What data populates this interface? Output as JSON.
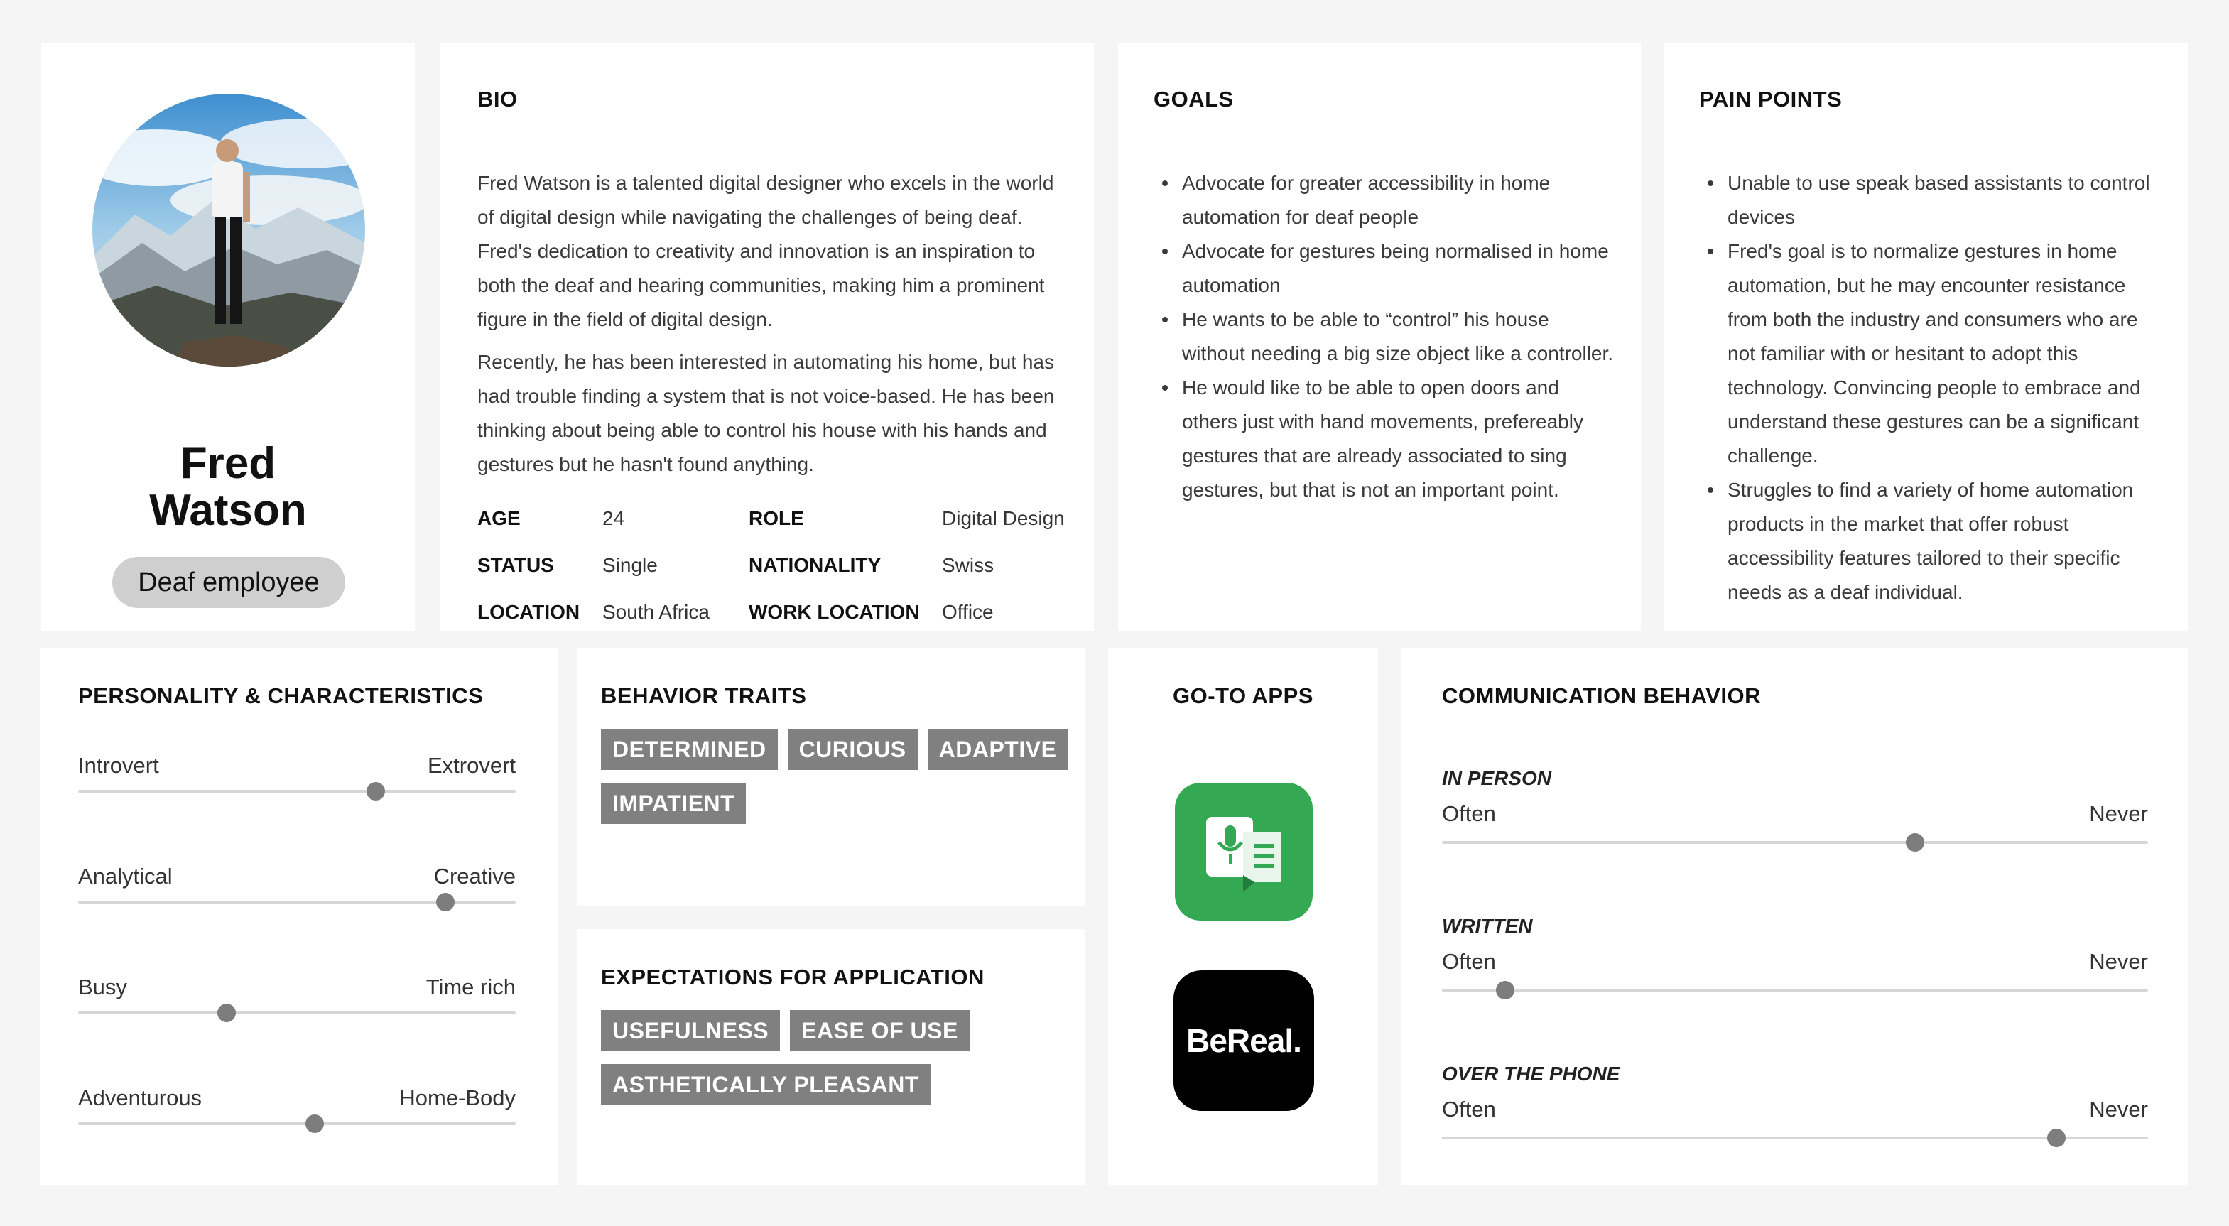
{
  "profile": {
    "first_name": "Fred",
    "last_name": "Watson",
    "badge": "Deaf employee"
  },
  "bio": {
    "heading": "BIO",
    "paragraph1": "Fred Watson is a talented digital designer who excels in the world of digital design while navigating the challenges of being deaf. Fred's dedication to creativity and innovation is an inspiration to both the deaf and hearing communities, making him a prominent figure in the field of digital design.",
    "paragraph2": "Recently, he has been interested in automating his home, but has had trouble finding a system that is not voice-based. He has been thinking about being able to control his house with his hands and gestures but he hasn't found anything.",
    "facts": [
      {
        "label": "AGE",
        "value": "24"
      },
      {
        "label": "ROLE",
        "value": "Digital Design"
      },
      {
        "label": "STATUS",
        "value": "Single"
      },
      {
        "label": "NATIONALITY",
        "value": "Swiss"
      },
      {
        "label": "LOCATION",
        "value": "South Africa"
      },
      {
        "label": "WORK LOCATION",
        "value": "Office"
      }
    ]
  },
  "goals": {
    "heading": "GOALS",
    "items": [
      "Advocate for greater accessibility in home automation for deaf people",
      "Advocate for gestures being normalised in home automation",
      "He wants to be able to “control” his house without needing a big size object like a controller.",
      "He would like to be able to open doors and others just with hand movements, prefereably gestures that are already associated to sing gestures, but that is not an important point."
    ]
  },
  "pain_points": {
    "heading": "PAIN POINTS",
    "items": [
      "Unable to use speak based assistants to control devices",
      "Fred's goal is to normalize gestures in home automation, but he may encounter resistance from both the industry and consumers who are not familiar with or hesitant to adopt this technology. Convincing people to embrace and understand these gestures can be a significant challenge.",
      "Struggles to find a variety of home automation products in the market that offer robust accessibility features tailored to their specific needs as a deaf individual."
    ]
  },
  "personality": {
    "heading": "PERSONALITY & CHARACTERISTICS",
    "sliders": [
      {
        "left": "Introvert",
        "right": "Extrovert",
        "level": 0.68
      },
      {
        "left": "Analytical",
        "right": "Creative",
        "level": 0.84
      },
      {
        "left": "Busy",
        "right": "Time rich",
        "level": 0.34
      },
      {
        "left": "Adventurous",
        "right": "Home-Body",
        "level": 0.54
      }
    ]
  },
  "behavior_traits": {
    "heading": "BEHAVIOR TRAITS",
    "tags": [
      "DETERMINED",
      "CURIOUS",
      "ADAPTIVE",
      "IMPATIENT"
    ]
  },
  "expectations": {
    "heading": "EXPECTATIONS FOR APPLICATION",
    "tags": [
      "USEFULNESS",
      "EASE OF USE",
      "ASTHETICALLY PLEASANT"
    ]
  },
  "apps": {
    "heading": "GO-TO APPS",
    "items": [
      {
        "icon": "live-transcribe-app-icon",
        "color": "#34a853",
        "label": ""
      },
      {
        "icon": "bereal-app-icon",
        "color": "#000000",
        "label": "BeReal."
      }
    ]
  },
  "communication": {
    "heading": "COMMUNICATION BEHAVIOR",
    "groups": [
      {
        "category": "IN PERSON",
        "left": "Often",
        "right": "Never",
        "level": 0.67
      },
      {
        "category": "WRITTEN",
        "left": "Often",
        "right": "Never",
        "level": 0.09
      },
      {
        "category": "OVER THE PHONE",
        "left": "Often",
        "right": "Never",
        "level": 0.87
      }
    ]
  }
}
